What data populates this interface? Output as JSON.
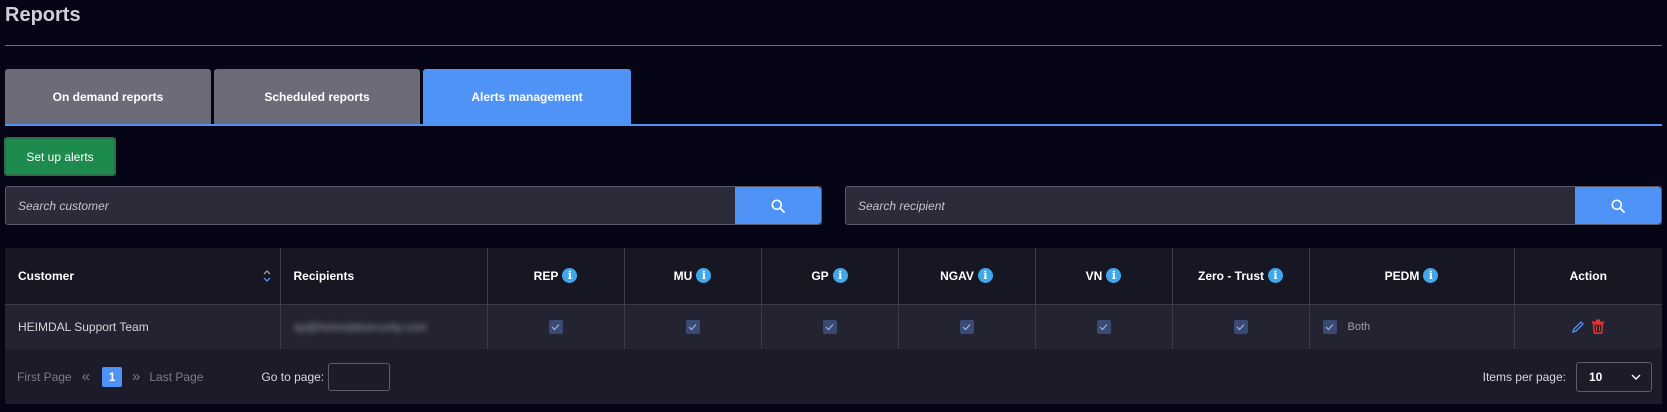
{
  "page": {
    "title": "Reports"
  },
  "tabs": [
    {
      "label": "On demand reports",
      "active": false
    },
    {
      "label": "Scheduled reports",
      "active": false
    },
    {
      "label": "Alerts management",
      "active": true
    }
  ],
  "setup_button": {
    "label": "Set up alerts"
  },
  "search_customer": {
    "placeholder": "Search customer",
    "icon": "search-icon"
  },
  "search_recipient": {
    "placeholder": "Search recipient",
    "icon": "search-icon"
  },
  "table": {
    "headers": {
      "customer": "Customer",
      "recipients": "Recipients",
      "rep": "REP",
      "mu": "MU",
      "gp": "GP",
      "ngav": "NGAV",
      "vn": "VN",
      "zero_trust": "Zero - Trust",
      "pedm": "PEDM",
      "action": "Action"
    },
    "rows": [
      {
        "customer": "HEIMDAL Support Team",
        "recipients": "sp@heimdalsecurity.com",
        "rep": true,
        "mu": true,
        "gp": true,
        "ngav": true,
        "vn": true,
        "zero_trust": true,
        "pedm": true,
        "pedm_label": "Both"
      }
    ]
  },
  "pagination": {
    "first_page": "First Page",
    "current_page": "1",
    "last_page": "Last Page",
    "goto_label": "Go to page:",
    "items_per_page_label": "Items per page:",
    "items_per_page": "10"
  },
  "colors": {
    "accent": "#4f93f7",
    "setup_green": "#1d8a4e",
    "info_blue": "#42a7ea",
    "delete_red": "#e53935"
  }
}
